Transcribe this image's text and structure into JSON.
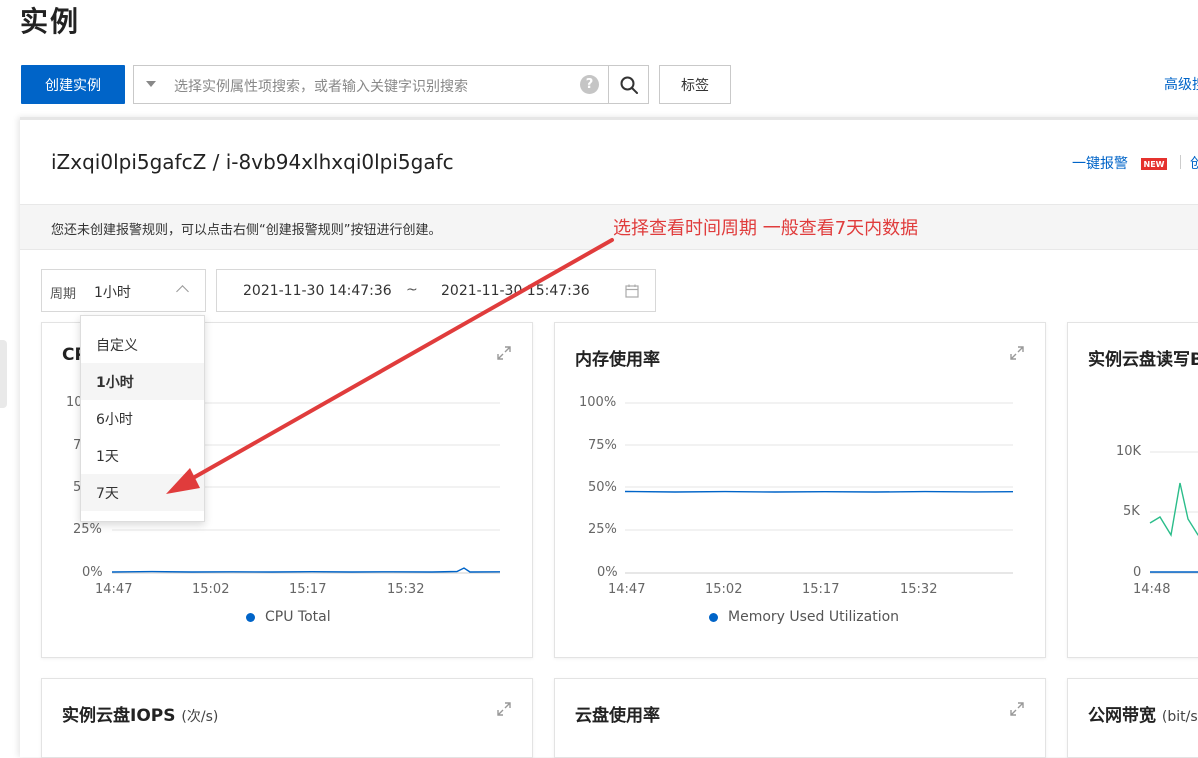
{
  "page": {
    "title": "实例"
  },
  "toolbar": {
    "create_label": "创建实例",
    "search_placeholder": "选择实例属性项搜索，或者输入关键字识别搜索",
    "help_glyph": "?",
    "tag_label": "标签",
    "advanced_label": "高级搜"
  },
  "instance": {
    "title": "iZxqi0lpi5gafcZ / i-8vb94xlhxqi0lpi5gafc",
    "alarm_link": "一键报警",
    "new_badge": "NEW",
    "more_link": "创",
    "notice": "您还未创建报警规则，可以点击右侧“创建报警规则”按钮进行创建。"
  },
  "period": {
    "label": "周期",
    "value": "1小时",
    "options": [
      {
        "label": "自定义",
        "selected": false
      },
      {
        "label": "1小时",
        "selected": true
      },
      {
        "label": "6小时",
        "selected": false
      },
      {
        "label": "1天",
        "selected": false
      },
      {
        "label": "7天",
        "selected": false
      }
    ]
  },
  "date_range": {
    "start": "2021-11-30 14:47:36",
    "separator": "~",
    "end": "2021-11-30 15:47:36"
  },
  "annotation": {
    "text": "选择查看时间周期 一般查看7天内数据",
    "color": "#e03c3c"
  },
  "colors": {
    "primary": "#0064c8",
    "series_blue": "#0064c8",
    "series_green": "#2bbd8a",
    "arrow": "#e03c3c"
  },
  "cards": {
    "cpu": {
      "title": "CPU",
      "legend": "CPU Total",
      "y_ticks": [
        "100%",
        "75%",
        "50%",
        "25%",
        "0%"
      ],
      "x_ticks": [
        "14:47",
        "15:02",
        "15:17",
        "15:32"
      ]
    },
    "memory": {
      "title": "内存使用率",
      "legend": "Memory Used Utilization",
      "y_ticks": [
        "100%",
        "75%",
        "50%",
        "25%",
        "0%"
      ],
      "x_ticks": [
        "14:47",
        "15:02",
        "15:17",
        "15:32"
      ]
    },
    "disk_rw": {
      "title": "实例云盘读写B",
      "y_ticks": [
        "10K",
        "5K",
        "0"
      ],
      "x_ticks": [
        "14:48"
      ]
    },
    "iops": {
      "title": "实例云盘IOPS",
      "unit": "(次/s)"
    },
    "disk_usage": {
      "title": "云盘使用率"
    },
    "bandwidth": {
      "title": "公网带宽",
      "unit": "(bit/s)"
    }
  }
}
